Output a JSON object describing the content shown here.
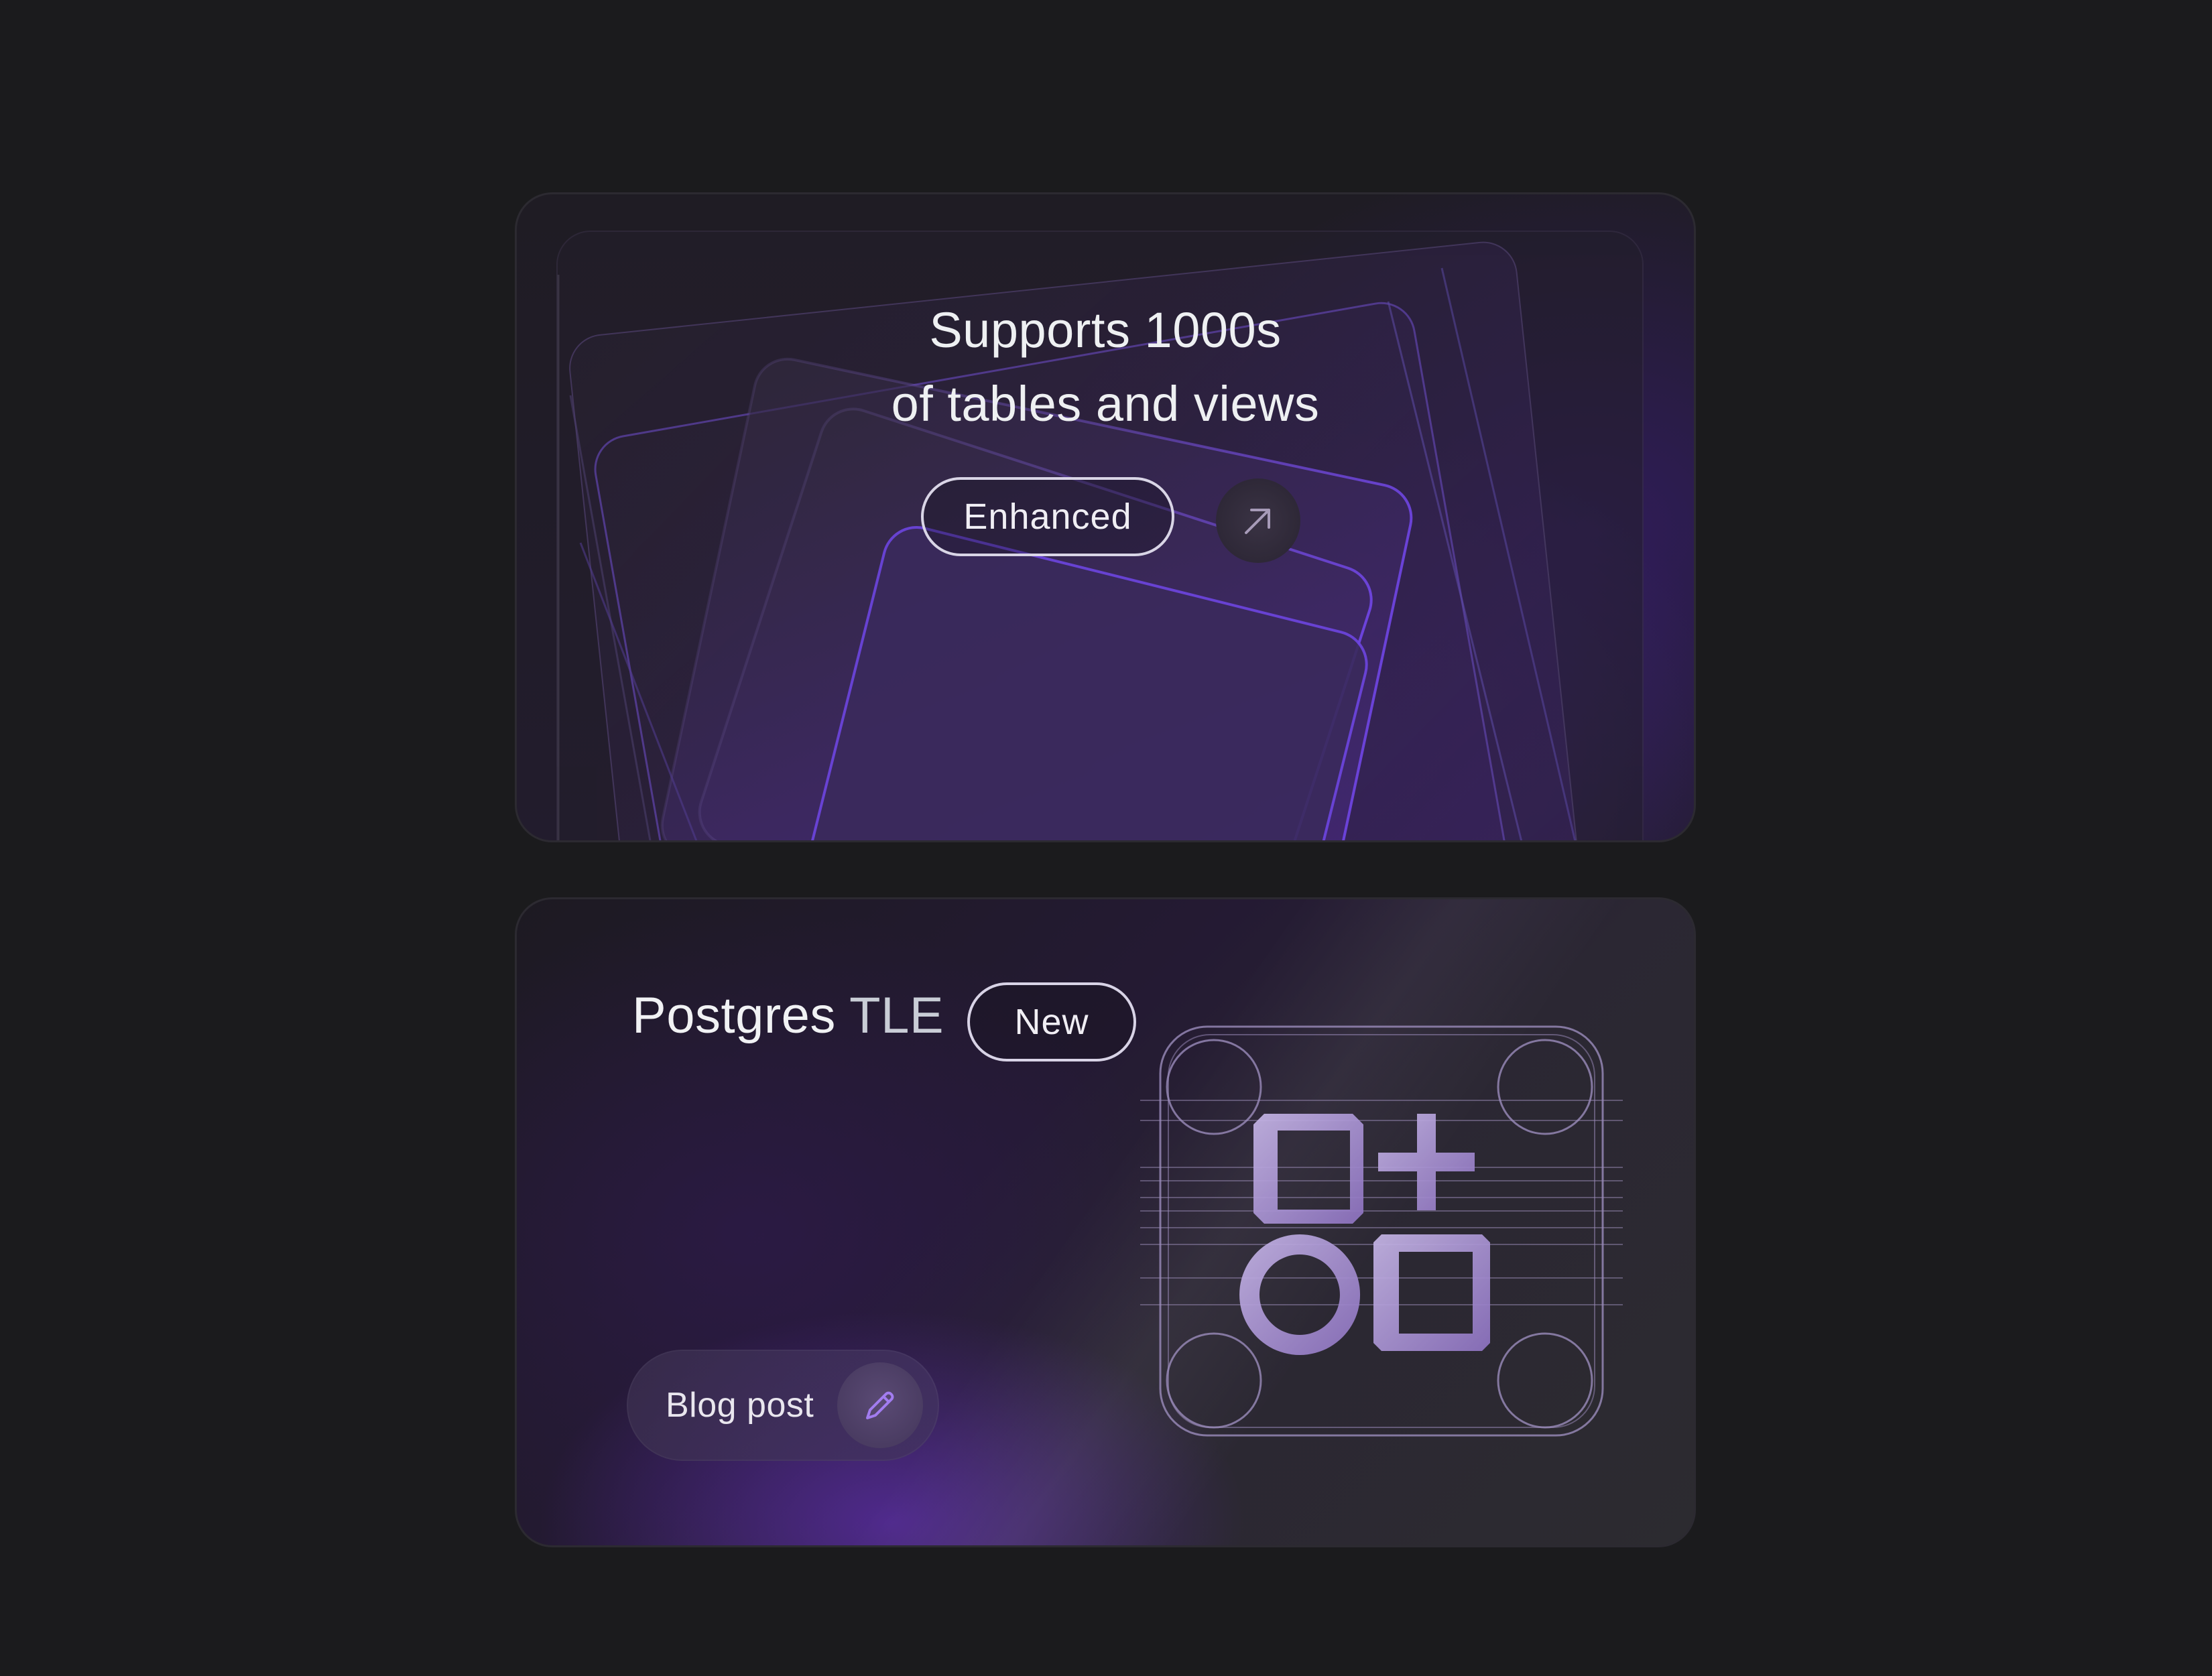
{
  "card_supports": {
    "headline_line1": "Supports 1000s",
    "headline_line2": "of tables and views",
    "badge_label": "Enhanced",
    "arrow_icon": "arrow-up-right-icon"
  },
  "card_tle": {
    "title_main": "Postgres",
    "title_accent": "TLE",
    "badge_label": "New",
    "blog_button_label": "Blog post",
    "blog_button_icon": "pencil-icon",
    "illustration": "tle-grid-icon"
  },
  "colors": {
    "page_background": "#1b1b1d",
    "accent_purple": "#7a4fd6",
    "text_primary": "#eef0f2"
  }
}
